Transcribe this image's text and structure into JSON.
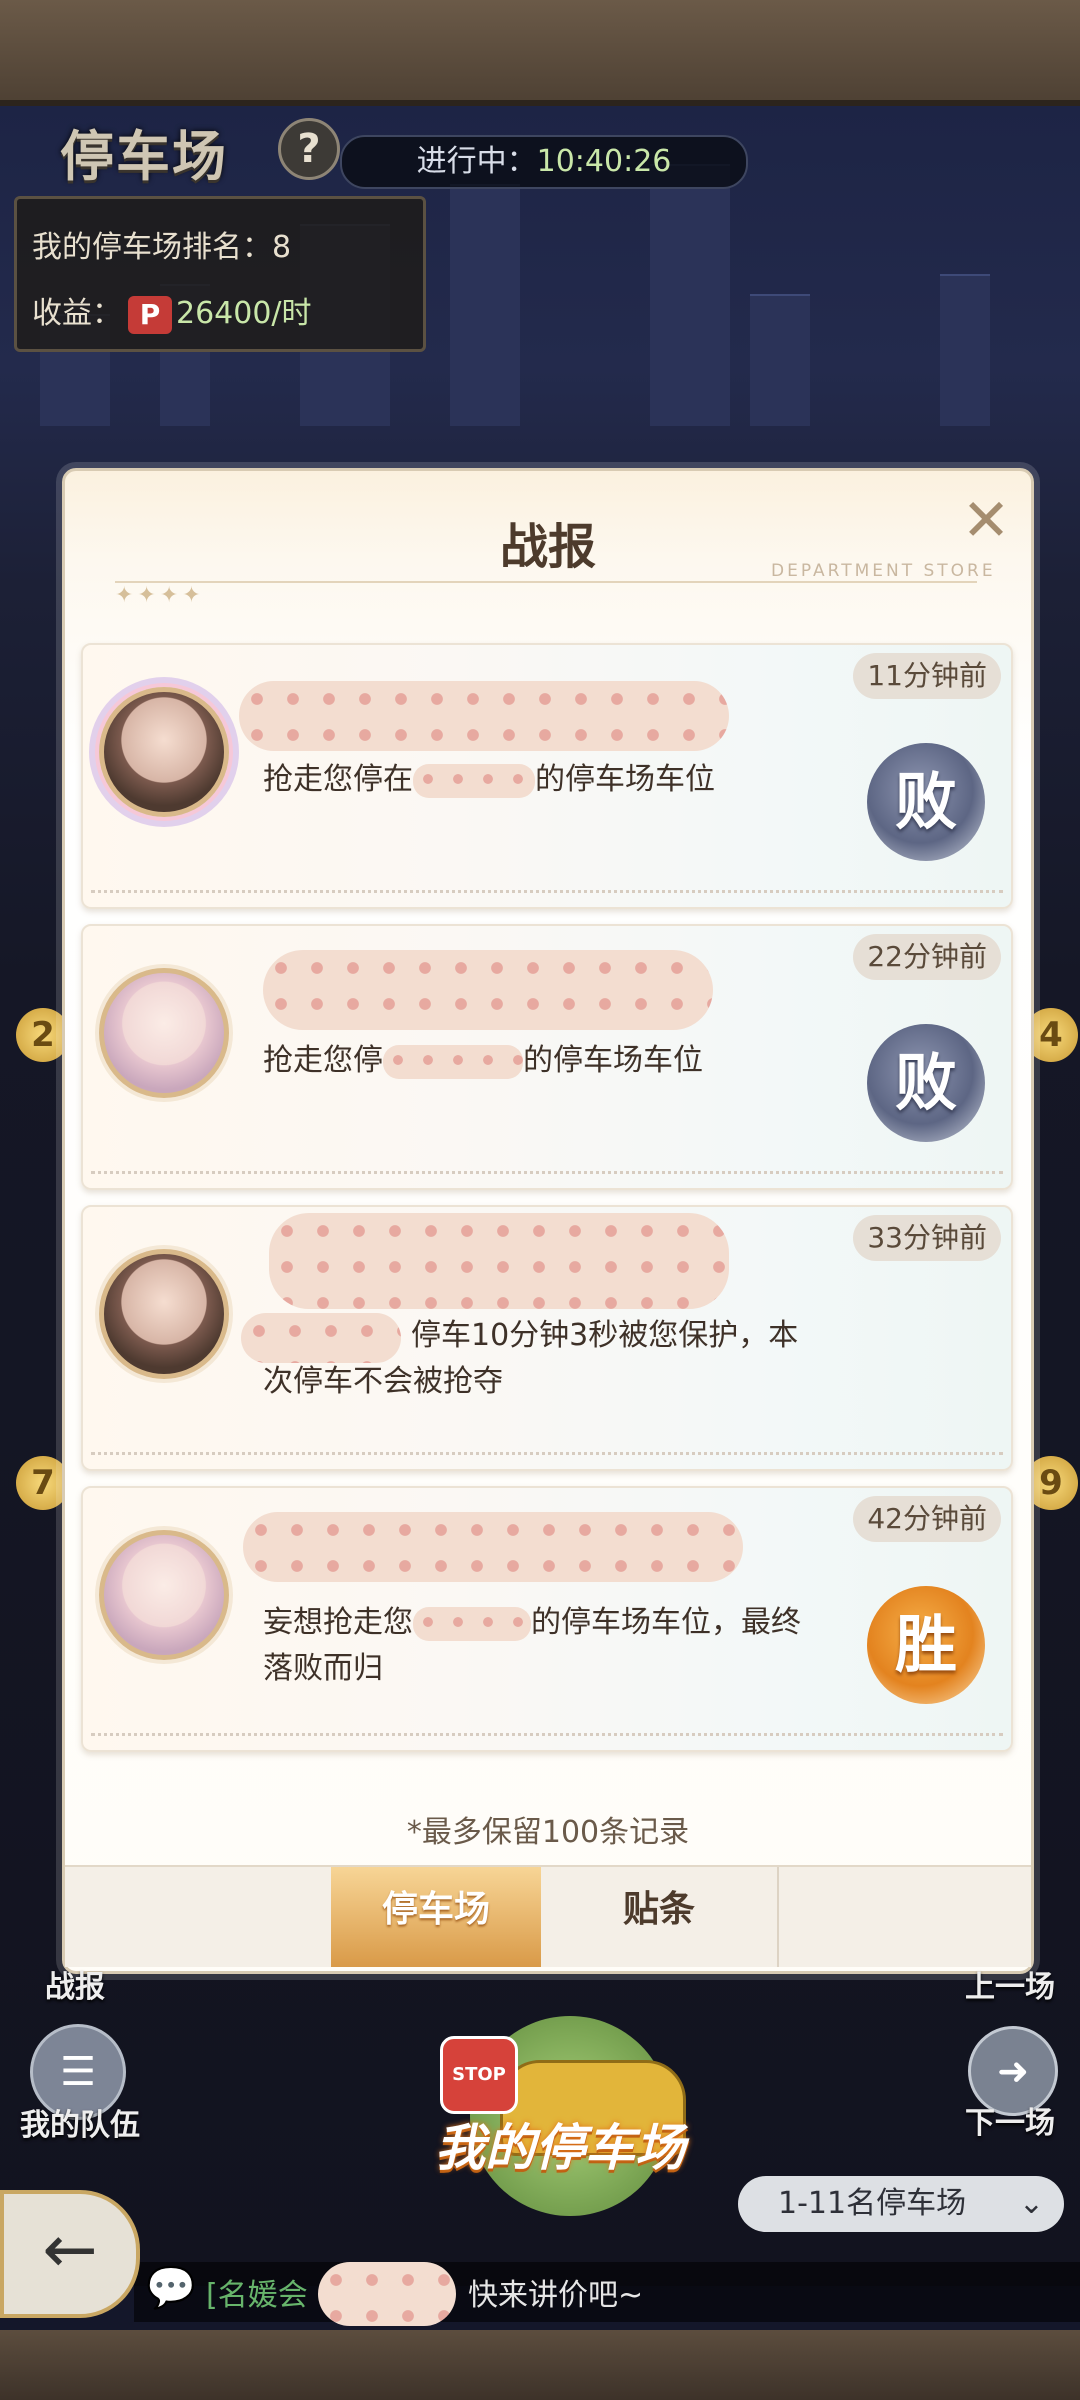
{
  "header": {
    "title": "停车场",
    "help_icon": "?",
    "status_prefix": "进行中：",
    "status_time": "10:40:26",
    "rank_text": "我的停车场排名：8",
    "income_label": "收益：",
    "income_badge": "P",
    "income_value": "26400/时"
  },
  "modal": {
    "title": "战报",
    "close_icon": "✕",
    "subtitle_en": "DEPARTMENT STORE",
    "stars": "✦✦✦✦",
    "reports": [
      {
        "time": "11分钟前",
        "text": "抢走您停在",
        "text_tail": "的停车场车位",
        "result": "败",
        "result_type": "lose"
      },
      {
        "time": "22分钟前",
        "text": "抢走您停",
        "text_tail": "的停车场车位",
        "result": "败",
        "result_type": "lose"
      },
      {
        "time": "33分钟前",
        "text": "停车10分钟3秒被您保护，本次停车不会被抢夺",
        "result": "",
        "result_type": "none"
      },
      {
        "time": "42分钟前",
        "text": "妄想抢走您",
        "text_tail": "的停车场车位，最终落败而归",
        "result": "胜",
        "result_type": "win"
      }
    ],
    "note": "*最多保留100条记录",
    "tabs": [
      {
        "label": "停车场",
        "active": true
      },
      {
        "label": "贴条",
        "active": false
      }
    ]
  },
  "side": {
    "battle_label": "战报",
    "my_team_label": "我的队伍",
    "prev_label": "上一场",
    "next_label": "下一场",
    "coin_left_a": "2",
    "coin_left_b": "7",
    "coin_right_a": "4",
    "coin_right_b": "9"
  },
  "bottom": {
    "my_lot_label": "我的停车场",
    "stop_sign": "STOP",
    "range_select": "1-11名停车场",
    "chat_channel": "[名媛会",
    "chat_message": "快来讲价吧~"
  },
  "colors": {
    "accent_gold": "#d99a48",
    "timer_green": "#c9e7a9",
    "lose_badge": "#5d6684",
    "win_badge": "#e3831f"
  }
}
